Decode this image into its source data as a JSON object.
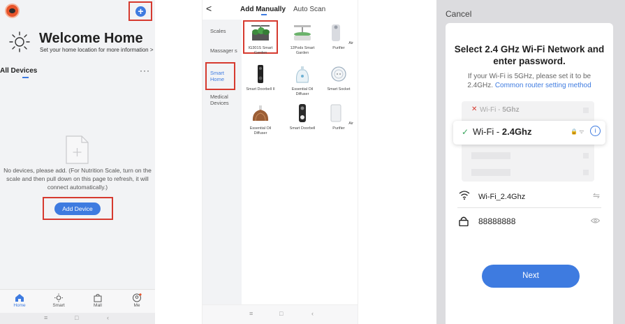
{
  "screen1": {
    "title": "Welcome Home",
    "subtitle": "Set your home location for more information >",
    "section_label": "All Devices",
    "more_glyph": "···",
    "empty_message": "No devices, please add. (For Nutrition Scale, turn on the scale and then pull down on this page to refresh, it will connect automatically.)",
    "add_device_label": "Add Device",
    "plus_glyph": "+",
    "nav": [
      {
        "label": "Home",
        "icon": "home-icon",
        "active": true
      },
      {
        "label": "Smart",
        "icon": "sun-icon",
        "active": false
      },
      {
        "label": "Mall",
        "icon": "shopping-bag-icon",
        "active": false
      },
      {
        "label": "Me",
        "icon": "user-icon",
        "active": false
      }
    ],
    "sys": {
      "menu": "≡",
      "home": "□",
      "back": "‹"
    }
  },
  "screen2": {
    "back_glyph": "<",
    "tabs": [
      {
        "label": "Add Manually",
        "active": true
      },
      {
        "label": "Auto Scan",
        "active": false
      }
    ],
    "categories": [
      {
        "label": "Scales",
        "active": false
      },
      {
        "label": "Massager s",
        "active": false
      },
      {
        "label": "Smart Home",
        "active": true
      },
      {
        "label": "Medical Devices",
        "active": false
      }
    ],
    "devices": [
      {
        "label": "IG301S Smart Garden",
        "icon": "smart-garden-icon"
      },
      {
        "label": "12Pods Smart Garden",
        "icon": "pods-garden-icon"
      },
      {
        "label": "Air Purifier",
        "icon": "air-purifier-icon"
      },
      {
        "label": "Smart Doorbell II",
        "icon": "doorbell-icon"
      },
      {
        "label": "Essential Oil Diffuser",
        "icon": "diffuser-icon"
      },
      {
        "label": "Smart Socket",
        "icon": "socket-icon"
      },
      {
        "label": "Essential Oil Diffuser",
        "icon": "wood-diffuser-icon"
      },
      {
        "label": "Smart Doorbell",
        "icon": "doorbell-icon"
      },
      {
        "label": "Air Purifier",
        "icon": "air-purifier-icon"
      }
    ],
    "sys": {
      "menu": "≡",
      "home": "□",
      "back": "‹"
    }
  },
  "screen3": {
    "cancel_label": "Cancel",
    "title": "Select 2.4 GHz Wi-Fi Network and enter password.",
    "desc_text": "If your Wi-Fi is 5GHz, please set it to be 2.4GHz.",
    "desc_link": "Common router setting method",
    "wifi_5g_prefix": "Wi-Fi - ",
    "wifi_5g_bold": "5Ghz",
    "wifi_24_prefix": "Wi-Fi - ",
    "wifi_24_bold": "2.4Ghz",
    "status_glyphs": "🔒 ᯤ",
    "info_glyph": "i",
    "x_glyph": "✕",
    "check_glyph": "✓",
    "ssid_value": "Wi-Fi_2.4Ghz",
    "swap_glyph": "⇋",
    "password_value": "88888888",
    "next_label": "Next"
  },
  "colors": {
    "accent": "#3e7be0",
    "highlight_box": "#d63a2f",
    "success": "#3aa55c"
  }
}
